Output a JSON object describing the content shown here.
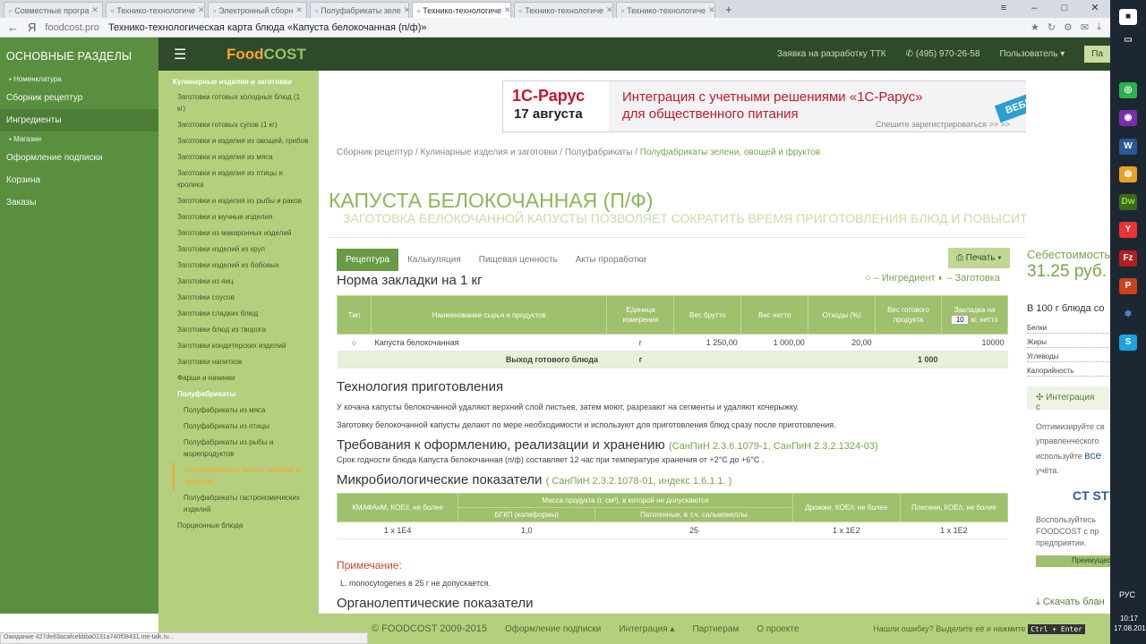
{
  "browser": {
    "tabs": [
      {
        "title": "Совместные програ",
        "active": false
      },
      {
        "title": "Технико-технологиче",
        "active": false
      },
      {
        "title": "Электронный сборн",
        "active": false
      },
      {
        "title": "Полуфабрикаты зеле",
        "active": false
      },
      {
        "title": "Технико-технологиче",
        "active": true
      },
      {
        "title": "Технико-технологиче",
        "active": false
      },
      {
        "title": "Технико-технологиче",
        "active": false
      }
    ],
    "host": "foodcost.pro",
    "page_title": "Технико-технологическая карта блюда «Капуста белокочанная (п/ф)»",
    "status_text": "Ожидание 427de83acafcebbba0131a740f08431.me-talk.ru..."
  },
  "left_menu": {
    "heading": "ОСНОВНЫЕ РАЗДЕЛЫ",
    "items": [
      {
        "label": "Номенклатура",
        "small": true
      },
      {
        "label": "Сборник рецептур"
      },
      {
        "label": "Ингредиенты",
        "active": true
      },
      {
        "label": "Магазин",
        "small": true
      },
      {
        "label": "Оформление подписки"
      },
      {
        "label": "Корзина"
      },
      {
        "label": "Заказы"
      }
    ]
  },
  "header": {
    "logo_a": "Food",
    "logo_b": "COST",
    "ttk_link": "Заявка на разработку ТТК",
    "phone": "(495) 970-26-58",
    "user": "Пользователь",
    "btn": "Па"
  },
  "catalog": {
    "heading": "Кулинарные изделия и заготовки",
    "items": [
      {
        "label": "Заготовки готовых холодных блюд (1 кг)"
      },
      {
        "label": "Заготовки готовых супов (1 кг)"
      },
      {
        "label": "Заготовки и изделия из овощей, грибов"
      },
      {
        "label": "Заготовки и изделия из мяса"
      },
      {
        "label": "Заготовки и изделия из птицы и кролика"
      },
      {
        "label": "Заготовки и изделия из рыбы и раков"
      },
      {
        "label": "Заготовки и мучные изделия"
      },
      {
        "label": "Заготовки из макаронных изделий"
      },
      {
        "label": "Заготовки изделий из круп"
      },
      {
        "label": "Заготовки изделий из бобовых"
      },
      {
        "label": "Заготовки из яиц"
      },
      {
        "label": "Заготовки соусов"
      },
      {
        "label": "Заготовки сладких блюд"
      },
      {
        "label": "Заготовки блюд из творога"
      },
      {
        "label": "Заготовки кондитерских изделий"
      },
      {
        "label": "Заготовки напитков"
      },
      {
        "label": "Фарши и начинки"
      },
      {
        "label": "Полуфабрикаты",
        "bold": true
      },
      {
        "label": "Полуфабрикаты из мяса",
        "sub": true
      },
      {
        "label": "Полуфабрикаты из птицы",
        "sub": true
      },
      {
        "label": "Полуфабрикаты из рыбы и морепродуктов",
        "sub": true
      },
      {
        "label": "Полуфабрикаты зелени, овощей и фруктов",
        "sub": true,
        "current": true
      },
      {
        "label": "Полуфабрикаты гастрономических изделий",
        "sub": true
      },
      {
        "label": "Порционные блюда"
      }
    ]
  },
  "banner": {
    "brand": "1С-Рарус",
    "date": "17 августа",
    "line1": "Интеграция с учетными решениями «1С-Рарус»",
    "line2": "для общественного питания",
    "register": "Спешите зарегистрироваться >> >>",
    "badge": "ВЕБИНАР"
  },
  "breadcrumbs": [
    "Сборник рецептур",
    "Кулинарные изделия и заготовки",
    "Полуфабрикаты",
    "Полуфабрикаты зелени, овощей и фруктов"
  ],
  "dish": {
    "title": "КАПУСТА БЕЛОКОЧАННАЯ (П/Ф)",
    "subtitle": "ЗАГОТОВКА БЕЛОКОЧАННОЙ КАПУСТЫ ПОЗВОЛЯЕТ СОКРАТИТЬ ВРЕМЯ ПРИГОТОВЛЕНИЯ БЛЮД И ПОВЫСИТЬ ТО"
  },
  "tabs": [
    "Рецептура",
    "Калькуляция",
    "Пищевая ценность",
    "Акты проработки"
  ],
  "print_label": "Печать",
  "legend": "○ – Ингредиент ◐ – Заготовка",
  "norm_heading": "Норма закладки на 1 кг",
  "recipe_table": {
    "headers": [
      "Тип",
      "Наименование сырья и продуктов",
      "Единица измерения",
      "Вес брутто",
      "Вес нетто",
      "Отходы (%)",
      "Вес готового продукта",
      "Закладка на",
      "кг, нетто"
    ],
    "portion_input": "10",
    "rows": [
      {
        "type": "○",
        "name": "Капуста белокочанная",
        "unit": "г",
        "brutto": "1 250,00",
        "netto": "1 000,00",
        "waste": "20,00",
        "ready": "",
        "load": "10000"
      }
    ],
    "yield_label": "Выход готового блюда",
    "yield_unit": "г",
    "yield_value": "1 000"
  },
  "technology": {
    "heading": "Технология приготовления",
    "p1": "У кочана капусты белокочанной удаляют верхний слой листьев, затем моют, разрезают на сегменты и удаляют кочерыжку.",
    "p2": "Заготовку белокочанной капусты делают по мере необходимости и используют для приготовления блюд сразу после приготовления."
  },
  "requirements": {
    "heading": "Требования к оформлению, реализации и хранению",
    "note": "(СанПиН 2.3.6.1079-1, СанПиН 2.3.2.1324-03)",
    "p": "Срок годности блюда Капуста белокочанная (п/ф) составляет 12  час при температуре хранения от +2°С до +6°С ."
  },
  "micro": {
    "heading": "Микробиологические показатели",
    "note": "( СанПиН 2.3.2.1078-01, индекс 1.6.1.1. )",
    "h_kmafanm": "КМАФАнМ, КОЕ/г, не более",
    "h_mass": "Масса продукта (г, см³), в которой не допускаются",
    "h_bgkp": "БГКП (колиформы)",
    "h_patho": "Патогенные, в т.ч. сальмонеллы",
    "h_yeast": "Дрожжи, КОЕ/г, не более",
    "h_mold": "Плесени, КОЕ/г, не более",
    "row": [
      "1 х 1Е4",
      "1,0",
      "25",
      "1 х 1Е2",
      "1 х 1Е2"
    ]
  },
  "note": {
    "heading": "Примечание:",
    "text": "L. monocytogenes в 25 г не допускается."
  },
  "organoleptic_heading": "Органолептические показатели",
  "side": {
    "cost_label": "Себестоимость",
    "cost_value": "31.25 руб.",
    "per100": "В 100 г блюда со",
    "nutrients": [
      "Белки",
      "Жиры",
      "Углеводы",
      "Калорийность"
    ],
    "integ": "Интеграция с",
    "itext": "Оптимизируйте св управленческого используйте",
    "itext_b": "все",
    "itext_c": "учёта.",
    "ct": "CT STY",
    "itext2": "Воспользуйтесь FOODCOST с пр предприятии.",
    "adv": "Преимущества",
    "download": "Скачать блан"
  },
  "footer": {
    "copyright": "© FOODCOST 2009-2015",
    "links": [
      "Оформление подписки",
      "Интеграция",
      "Партнерам",
      "О проекте"
    ],
    "error": "Нашли ошибку? Выделите её и нажмите",
    "kbd": "Ctrl + Enter"
  },
  "taskbar": {
    "lang": "РУС",
    "time": "10:17",
    "date": "17.08.2015"
  }
}
